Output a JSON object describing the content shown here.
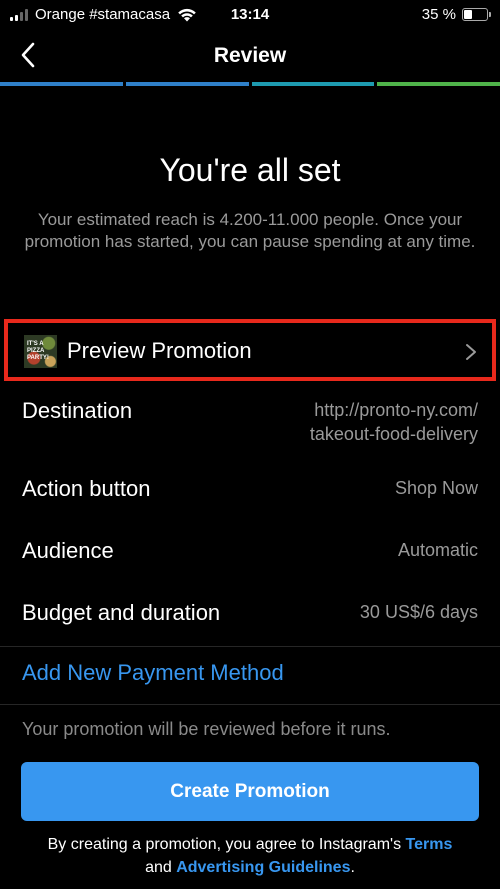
{
  "status_bar": {
    "carrier": "Orange #stamacasa",
    "time": "13:14",
    "battery": "35 %",
    "battery_level": 0.35,
    "icons": [
      "signal-icon",
      "wifi-icon",
      "battery-icon"
    ]
  },
  "nav": {
    "title": "Review",
    "back_icon": "chevron-left-icon"
  },
  "progress": {
    "steps": 4,
    "colors": [
      "#2f80c9",
      "#2f80c9",
      "#1e9bb0",
      "#4fb34a"
    ]
  },
  "hero": {
    "title": "You're all set",
    "subtitle": "Your estimated reach is 4.200-11.000 people. Once your promotion has started, you can pause spending at any time."
  },
  "preview": {
    "label": "Preview Promotion",
    "thumb_text": "IT'S A PIZZA PARTY!",
    "chevron_icon": "chevron-right-icon",
    "highlight_color": "#e8291c"
  },
  "details": [
    {
      "key": "Destination",
      "value_line1": "http://pronto-ny.com/",
      "value_line2": "takeout-food-delivery"
    },
    {
      "key": "Action button",
      "value": "Shop Now"
    },
    {
      "key": "Audience",
      "value": "Automatic"
    },
    {
      "key": "Budget and duration",
      "value": "30 US$/6 days"
    }
  ],
  "payment": {
    "add_label": "Add New Payment Method"
  },
  "review_note": "Your promotion will be reviewed before it runs.",
  "cta": {
    "label": "Create Promotion",
    "color": "#3897f0"
  },
  "legal": {
    "prefix": "By creating a promotion, you agree to Instagram's ",
    "terms_link": "Terms",
    "middle": "and ",
    "guidelines_link": "Advertising Guidelines",
    "suffix": "."
  }
}
